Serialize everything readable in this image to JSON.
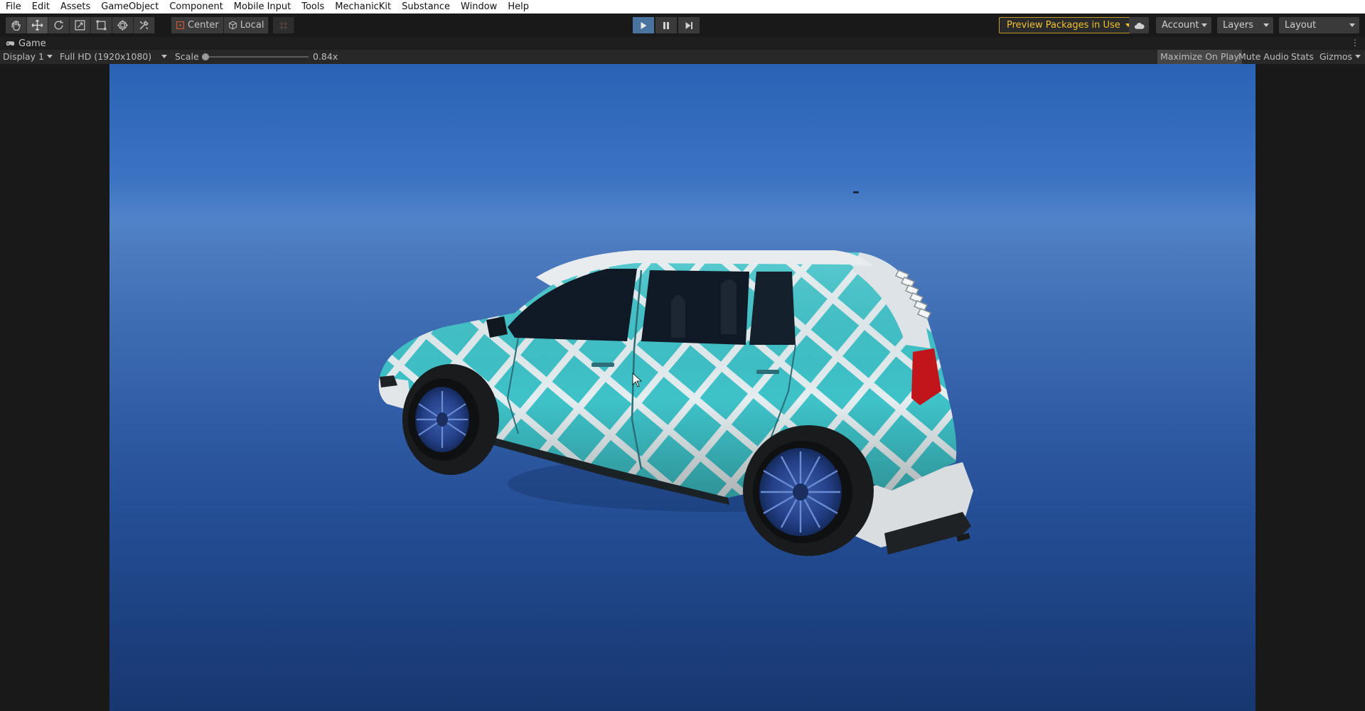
{
  "menu": [
    "File",
    "Edit",
    "Assets",
    "GameObject",
    "Component",
    "Mobile Input",
    "Tools",
    "MechanicKit",
    "Substance",
    "Window",
    "Help"
  ],
  "toolbar": {
    "tools": [
      "hand-tool",
      "move-tool",
      "rotate-tool",
      "scale-tool",
      "rect-tool",
      "transform-tool",
      "custom-tool"
    ],
    "pivot_label": "Center",
    "space_label": "Local",
    "preview_packages_label": "Preview Packages in Use",
    "account_label": "Account",
    "layers_label": "Layers",
    "layout_label": "Layout"
  },
  "game_tab": {
    "label": "Game"
  },
  "game_bar": {
    "display": "Display 1",
    "resolution": "Full HD (1920x1080)",
    "scale_label": "Scale",
    "scale_value": "0.84x",
    "maximize_label": "Maximize On Play",
    "mute_label": "Mute Audio",
    "stats_label": "Stats",
    "gizmos_label": "Gizmos"
  },
  "colors": {
    "play_active": "#4b73a0",
    "preview_border": "#c59a24",
    "car_body": "#3ec3c9",
    "car_stripes": "#e4eef0",
    "sky_top": "#2a62b5",
    "sky_bottom": "#173770"
  }
}
